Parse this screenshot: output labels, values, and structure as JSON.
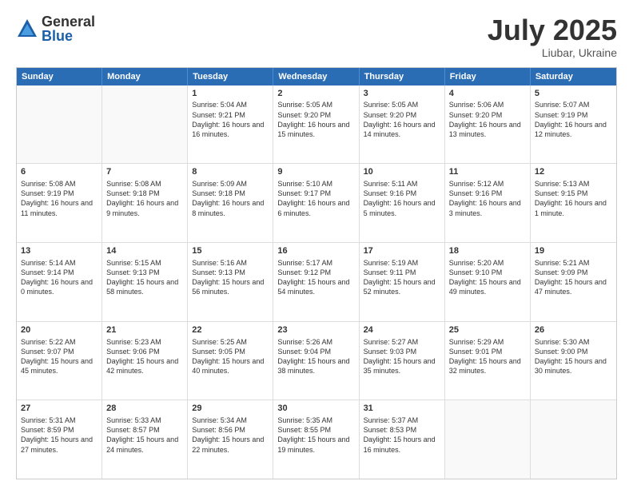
{
  "header": {
    "logo": {
      "general": "General",
      "blue": "Blue"
    },
    "title": "July 2025",
    "subtitle": "Liubar, Ukraine"
  },
  "weekdays": [
    "Sunday",
    "Monday",
    "Tuesday",
    "Wednesday",
    "Thursday",
    "Friday",
    "Saturday"
  ],
  "rows": [
    [
      {
        "day": "",
        "empty": true
      },
      {
        "day": "",
        "empty": true
      },
      {
        "day": "1",
        "sunrise": "Sunrise: 5:04 AM",
        "sunset": "Sunset: 9:21 PM",
        "daylight": "Daylight: 16 hours and 16 minutes."
      },
      {
        "day": "2",
        "sunrise": "Sunrise: 5:05 AM",
        "sunset": "Sunset: 9:20 PM",
        "daylight": "Daylight: 16 hours and 15 minutes."
      },
      {
        "day": "3",
        "sunrise": "Sunrise: 5:05 AM",
        "sunset": "Sunset: 9:20 PM",
        "daylight": "Daylight: 16 hours and 14 minutes."
      },
      {
        "day": "4",
        "sunrise": "Sunrise: 5:06 AM",
        "sunset": "Sunset: 9:20 PM",
        "daylight": "Daylight: 16 hours and 13 minutes."
      },
      {
        "day": "5",
        "sunrise": "Sunrise: 5:07 AM",
        "sunset": "Sunset: 9:19 PM",
        "daylight": "Daylight: 16 hours and 12 minutes."
      }
    ],
    [
      {
        "day": "6",
        "sunrise": "Sunrise: 5:08 AM",
        "sunset": "Sunset: 9:19 PM",
        "daylight": "Daylight: 16 hours and 11 minutes."
      },
      {
        "day": "7",
        "sunrise": "Sunrise: 5:08 AM",
        "sunset": "Sunset: 9:18 PM",
        "daylight": "Daylight: 16 hours and 9 minutes."
      },
      {
        "day": "8",
        "sunrise": "Sunrise: 5:09 AM",
        "sunset": "Sunset: 9:18 PM",
        "daylight": "Daylight: 16 hours and 8 minutes."
      },
      {
        "day": "9",
        "sunrise": "Sunrise: 5:10 AM",
        "sunset": "Sunset: 9:17 PM",
        "daylight": "Daylight: 16 hours and 6 minutes."
      },
      {
        "day": "10",
        "sunrise": "Sunrise: 5:11 AM",
        "sunset": "Sunset: 9:16 PM",
        "daylight": "Daylight: 16 hours and 5 minutes."
      },
      {
        "day": "11",
        "sunrise": "Sunrise: 5:12 AM",
        "sunset": "Sunset: 9:16 PM",
        "daylight": "Daylight: 16 hours and 3 minutes."
      },
      {
        "day": "12",
        "sunrise": "Sunrise: 5:13 AM",
        "sunset": "Sunset: 9:15 PM",
        "daylight": "Daylight: 16 hours and 1 minute."
      }
    ],
    [
      {
        "day": "13",
        "sunrise": "Sunrise: 5:14 AM",
        "sunset": "Sunset: 9:14 PM",
        "daylight": "Daylight: 16 hours and 0 minutes."
      },
      {
        "day": "14",
        "sunrise": "Sunrise: 5:15 AM",
        "sunset": "Sunset: 9:13 PM",
        "daylight": "Daylight: 15 hours and 58 minutes."
      },
      {
        "day": "15",
        "sunrise": "Sunrise: 5:16 AM",
        "sunset": "Sunset: 9:13 PM",
        "daylight": "Daylight: 15 hours and 56 minutes."
      },
      {
        "day": "16",
        "sunrise": "Sunrise: 5:17 AM",
        "sunset": "Sunset: 9:12 PM",
        "daylight": "Daylight: 15 hours and 54 minutes."
      },
      {
        "day": "17",
        "sunrise": "Sunrise: 5:19 AM",
        "sunset": "Sunset: 9:11 PM",
        "daylight": "Daylight: 15 hours and 52 minutes."
      },
      {
        "day": "18",
        "sunrise": "Sunrise: 5:20 AM",
        "sunset": "Sunset: 9:10 PM",
        "daylight": "Daylight: 15 hours and 49 minutes."
      },
      {
        "day": "19",
        "sunrise": "Sunrise: 5:21 AM",
        "sunset": "Sunset: 9:09 PM",
        "daylight": "Daylight: 15 hours and 47 minutes."
      }
    ],
    [
      {
        "day": "20",
        "sunrise": "Sunrise: 5:22 AM",
        "sunset": "Sunset: 9:07 PM",
        "daylight": "Daylight: 15 hours and 45 minutes."
      },
      {
        "day": "21",
        "sunrise": "Sunrise: 5:23 AM",
        "sunset": "Sunset: 9:06 PM",
        "daylight": "Daylight: 15 hours and 42 minutes."
      },
      {
        "day": "22",
        "sunrise": "Sunrise: 5:25 AM",
        "sunset": "Sunset: 9:05 PM",
        "daylight": "Daylight: 15 hours and 40 minutes."
      },
      {
        "day": "23",
        "sunrise": "Sunrise: 5:26 AM",
        "sunset": "Sunset: 9:04 PM",
        "daylight": "Daylight: 15 hours and 38 minutes."
      },
      {
        "day": "24",
        "sunrise": "Sunrise: 5:27 AM",
        "sunset": "Sunset: 9:03 PM",
        "daylight": "Daylight: 15 hours and 35 minutes."
      },
      {
        "day": "25",
        "sunrise": "Sunrise: 5:29 AM",
        "sunset": "Sunset: 9:01 PM",
        "daylight": "Daylight: 15 hours and 32 minutes."
      },
      {
        "day": "26",
        "sunrise": "Sunrise: 5:30 AM",
        "sunset": "Sunset: 9:00 PM",
        "daylight": "Daylight: 15 hours and 30 minutes."
      }
    ],
    [
      {
        "day": "27",
        "sunrise": "Sunrise: 5:31 AM",
        "sunset": "Sunset: 8:59 PM",
        "daylight": "Daylight: 15 hours and 27 minutes."
      },
      {
        "day": "28",
        "sunrise": "Sunrise: 5:33 AM",
        "sunset": "Sunset: 8:57 PM",
        "daylight": "Daylight: 15 hours and 24 minutes."
      },
      {
        "day": "29",
        "sunrise": "Sunrise: 5:34 AM",
        "sunset": "Sunset: 8:56 PM",
        "daylight": "Daylight: 15 hours and 22 minutes."
      },
      {
        "day": "30",
        "sunrise": "Sunrise: 5:35 AM",
        "sunset": "Sunset: 8:55 PM",
        "daylight": "Daylight: 15 hours and 19 minutes."
      },
      {
        "day": "31",
        "sunrise": "Sunrise: 5:37 AM",
        "sunset": "Sunset: 8:53 PM",
        "daylight": "Daylight: 15 hours and 16 minutes."
      },
      {
        "day": "",
        "empty": true
      },
      {
        "day": "",
        "empty": true
      }
    ]
  ]
}
